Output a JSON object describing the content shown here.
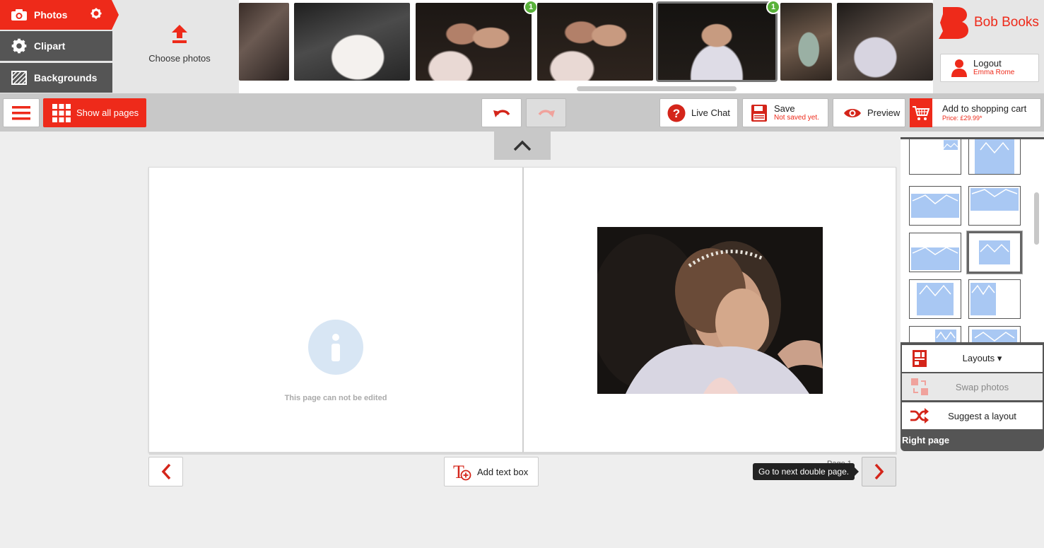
{
  "tabs": {
    "photos": "Photos",
    "clipart": "Clipart",
    "backgrounds": "Backgrounds"
  },
  "upload": {
    "label": "Choose photos"
  },
  "thumbnails": [
    {
      "name": "thumb-1",
      "badge": ""
    },
    {
      "name": "thumb-2",
      "badge": ""
    },
    {
      "name": "thumb-3",
      "badge": "1"
    },
    {
      "name": "thumb-4",
      "badge": ""
    },
    {
      "name": "thumb-5",
      "badge": "1",
      "selected": true
    },
    {
      "name": "thumb-6",
      "badge": ""
    },
    {
      "name": "thumb-7",
      "badge": ""
    }
  ],
  "brand": {
    "name": "Bob Books",
    "color": "#ee2a1a"
  },
  "user": {
    "logout_label": "Logout",
    "name": "Emma Rome"
  },
  "toolbar": {
    "show_all_pages": "Show all pages",
    "live_chat": "Live Chat",
    "save_label": "Save",
    "save_status": "Not saved yet.",
    "preview": "Preview",
    "cart_label": "Add to shopping cart",
    "cart_price": "Price: £29.99*"
  },
  "book": {
    "left_page_message": "This page can not be edited",
    "page_label": "Page 1"
  },
  "navigation": {
    "add_text_box": "Add text box",
    "next_tooltip": "Go to next double page."
  },
  "layout_panel": {
    "layouts_label": "Layouts",
    "swap_photos": "Swap photos",
    "suggest_layout": "Suggest a layout",
    "section_label": "Right page"
  },
  "colors": {
    "accent": "#ee2a1a",
    "success_badge": "#59b23a",
    "placeholder_blue": "#a9c8f3"
  }
}
